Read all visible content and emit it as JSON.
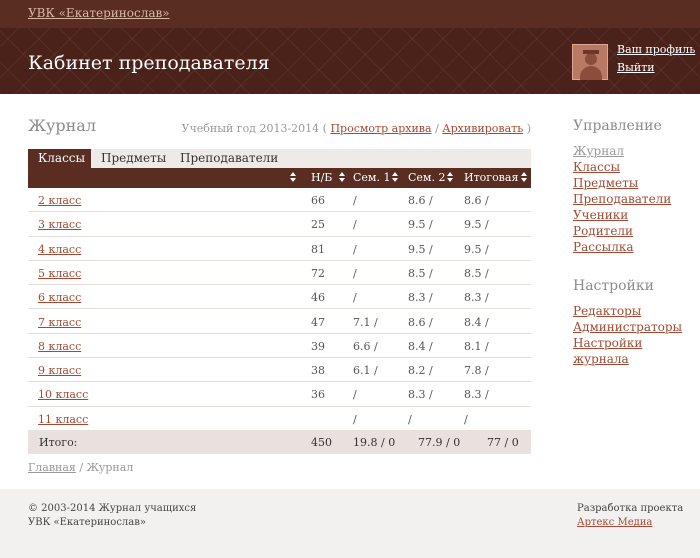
{
  "top": {
    "org_link": "УВК «Екатеринослав»"
  },
  "header": {
    "title": "Кабинет преподавателя",
    "profile": "Ваш профиль",
    "logout": "Выйти"
  },
  "main": {
    "title": "Журнал",
    "year_prefix": "Учебный год 2013-2014 (",
    "archive_view": "Просмотр архива",
    "slash": "/",
    "archive": "Архивировать",
    "year_suffix": ")",
    "tabs": [
      "Классы",
      "Предметы",
      "Преподаватели"
    ],
    "columns": [
      "Н/Б",
      "Сем. 1",
      "Сем. 2",
      "Итоговая"
    ],
    "rows": [
      {
        "name": "2 класс",
        "nb": "66",
        "s1": "/",
        "s2": "8.6 /",
        "fin": "8.6 /"
      },
      {
        "name": "3 класс",
        "nb": "25",
        "s1": "/",
        "s2": "9.5 /",
        "fin": "9.5 /"
      },
      {
        "name": "4 класс",
        "nb": "81",
        "s1": "/",
        "s2": "9.5 /",
        "fin": "9.5 /"
      },
      {
        "name": "5 класс",
        "nb": "72",
        "s1": "/",
        "s2": "8.5 /",
        "fin": "8.5 /"
      },
      {
        "name": "6 класс",
        "nb": "46",
        "s1": "/",
        "s2": "8.3 /",
        "fin": "8.3 /"
      },
      {
        "name": "7 класс",
        "nb": "47",
        "s1": "7.1 /",
        "s2": "8.6 /",
        "fin": "8.4 /"
      },
      {
        "name": "8 класс",
        "nb": "39",
        "s1": "6.6 /",
        "s2": "8.4 /",
        "fin": "8.1 /"
      },
      {
        "name": "9 класс",
        "nb": "38",
        "s1": "6.1 /",
        "s2": "8.2 /",
        "fin": "7.8 /"
      },
      {
        "name": "10 класс",
        "nb": "36",
        "s1": "/",
        "s2": "8.3 /",
        "fin": "8.3 /"
      },
      {
        "name": "11 класс",
        "nb": "",
        "s1": "/",
        "s2": "/",
        "fin": "/"
      }
    ],
    "total": {
      "label": "Итого:",
      "nb": "450",
      "s1": "19.8 / 0",
      "s2": "77.9 / 0",
      "fin": "77 / 0"
    },
    "breadcrumb": {
      "home": "Главная",
      "sep": " / ",
      "current": "Журнал"
    }
  },
  "sidebar": {
    "manage_title": "Управление",
    "manage_items": [
      "Журнал",
      "Классы",
      "Предметы",
      "Преподаватели",
      "Ученики",
      "Родители",
      "Рассылка"
    ],
    "settings_title": "Настройки",
    "settings_items": [
      "Редакторы",
      "Администраторы",
      "Настройки журнала"
    ]
  },
  "footer": {
    "copyright": "© 2003-2014 Журнал учащихся",
    "org": "УВК «Екатеринослав»",
    "dev": "Разработка проекта",
    "dev_link": "Артекс Медиа"
  }
}
